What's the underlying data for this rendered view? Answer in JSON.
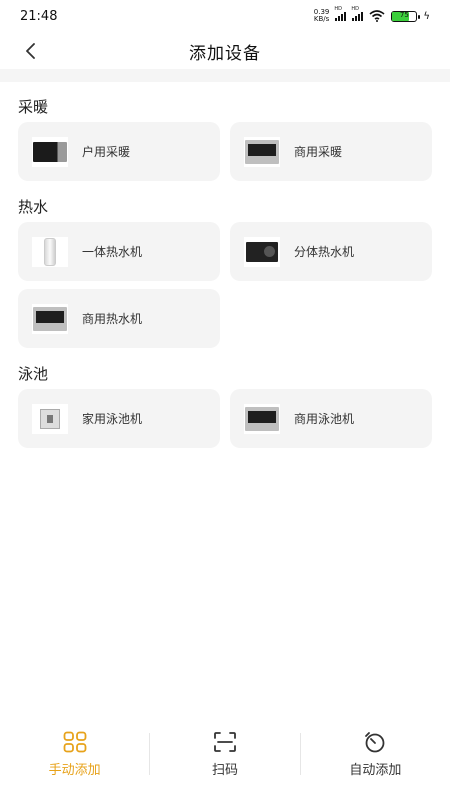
{
  "status_bar": {
    "time": "21:48",
    "net_speed_value": "0.39",
    "net_speed_unit": "KB/s",
    "signal_hd_1": "HD",
    "signal_hd_2": "HD",
    "battery_level": "75"
  },
  "header": {
    "title": "添加设备"
  },
  "sections": [
    {
      "title": "采暖",
      "items": [
        {
          "label": "户用采暖",
          "icon": "heat-pump-dark-icon"
        },
        {
          "label": "商用采暖",
          "icon": "commercial-unit-icon"
        }
      ]
    },
    {
      "title": "热水",
      "items": [
        {
          "label": "一体热水机",
          "icon": "water-tank-icon"
        },
        {
          "label": "分体热水机",
          "icon": "split-unit-icon"
        },
        {
          "label": "商用热水机",
          "icon": "commercial-unit-icon"
        }
      ]
    },
    {
      "title": "泳池",
      "items": [
        {
          "label": "家用泳池机",
          "icon": "small-unit-icon"
        },
        {
          "label": "商用泳池机",
          "icon": "commercial-unit-icon"
        }
      ]
    }
  ],
  "tabbar": {
    "manual": "手动添加",
    "scan": "扫码",
    "auto": "自动添加"
  },
  "colors": {
    "accent": "#e7a21a",
    "card_bg": "#f4f4f4"
  }
}
